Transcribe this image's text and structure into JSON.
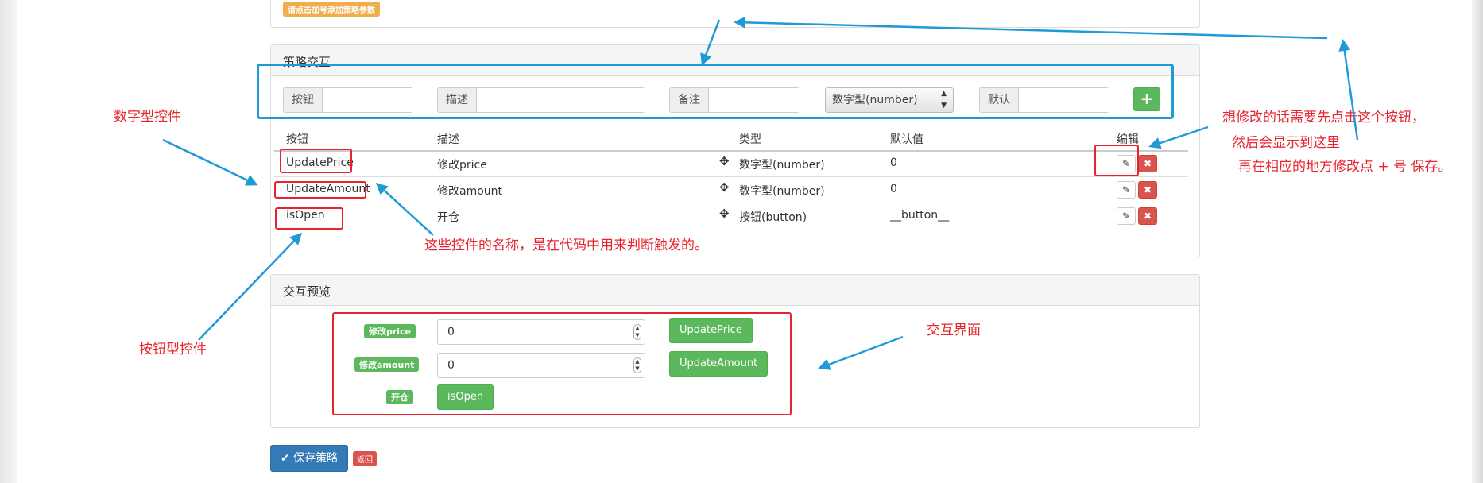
{
  "top_panel": {
    "hint_badge": "请点击加号添加策略参数"
  },
  "interaction_panel": {
    "title": "策略交互",
    "form": {
      "button_addon": "按钮",
      "desc_addon": "描述",
      "remark_addon": "备注",
      "type_select": "数字型(number)",
      "default_addon": "默认",
      "add_button": "+"
    },
    "table": {
      "headers": {
        "button": "按钮",
        "desc": "描述",
        "type": "类型",
        "default": "默认值",
        "edit": "编辑"
      },
      "rows": [
        {
          "button": "UpdatePrice",
          "desc": "修改price",
          "type": "数字型(number)",
          "default": "0"
        },
        {
          "button": "UpdateAmount",
          "desc": "修改amount",
          "type": "数字型(number)",
          "default": "0"
        },
        {
          "button": "isOpen",
          "desc": "开仓",
          "type": "按钮(button)",
          "default": "__button__"
        }
      ]
    }
  },
  "preview_panel": {
    "title": "交互预览",
    "rows": [
      {
        "label": "修改price",
        "value": "0",
        "button": "UpdatePrice"
      },
      {
        "label": "修改amount",
        "value": "0",
        "button": "UpdateAmount"
      },
      {
        "label": "开仓",
        "button": "isOpen"
      }
    ]
  },
  "footer": {
    "save_button": "保存策略",
    "back_button": "返回"
  },
  "annotations": {
    "number_control": "数字型控件",
    "button_control": "按钮型控件",
    "control_names": "这些控件的名称，是在代码中用来判断触发的。",
    "edit_hint_1": "想修改的话需要先点击这个按钮，",
    "edit_hint_2": "然后会显示到这里",
    "edit_hint_3": "再在相应的地方修改点 + 号 保存。",
    "interaction_ui": "交互界面"
  },
  "colors": {
    "annotation_red": "#e8232e",
    "annotation_blue": "#1f9ad6",
    "success": "#5cb85c",
    "danger": "#d9534f",
    "primary": "#337ab7",
    "warning": "#f0ad4e"
  }
}
